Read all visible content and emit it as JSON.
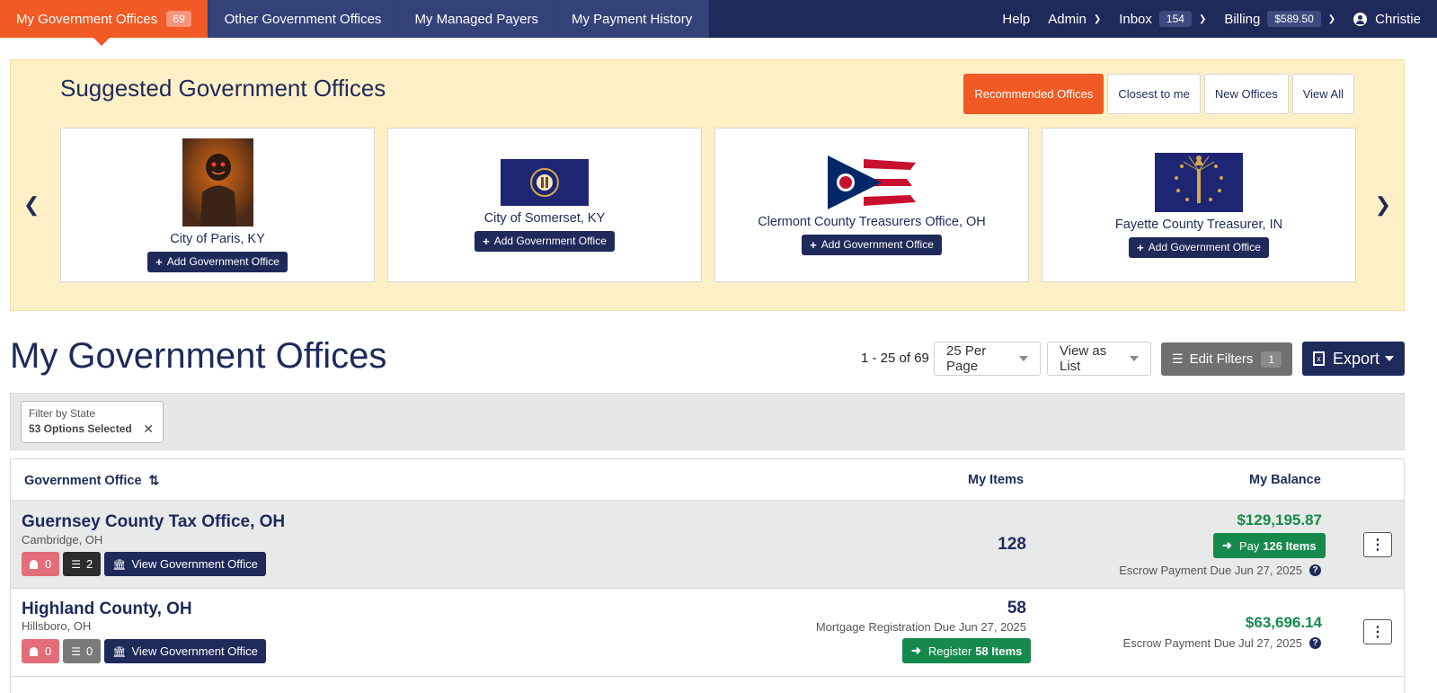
{
  "nav": {
    "tabs": [
      {
        "label": "My Government Offices",
        "badge": "69"
      },
      {
        "label": "Other Government Offices"
      },
      {
        "label": "My Managed Payers"
      },
      {
        "label": "My Payment History"
      }
    ],
    "help": "Help",
    "admin": "Admin",
    "inbox": {
      "label": "Inbox",
      "badge": "154"
    },
    "billing": {
      "label": "Billing",
      "badge": "$589.50"
    },
    "user": "Christie"
  },
  "suggested": {
    "title": "Suggested Government Offices",
    "filters": [
      "Recommended Offices",
      "Closest to me",
      "New Offices",
      "View All"
    ],
    "add_label": "Add Government Office",
    "cards": [
      {
        "name": "City of Paris, KY"
      },
      {
        "name": "City of Somerset, KY"
      },
      {
        "name": "Clermont County Treasurers Office, OH"
      },
      {
        "name": "Fayette County Treasurer, IN"
      }
    ]
  },
  "section": {
    "title": "My Government Offices",
    "pager": "1 - 25 of 69",
    "per_page": "25 Per Page",
    "view_as": "View as List",
    "edit_filters": "Edit Filters",
    "filter_count": "1",
    "export": "Export"
  },
  "filter_chip": {
    "label": "Filter by State",
    "value": "53 Options Selected"
  },
  "table": {
    "headers": {
      "office": "Government Office",
      "items": "My Items",
      "balance": "My Balance"
    },
    "view_label": "View Government Office",
    "rows": [
      {
        "name": "Guernsey County Tax Office, OH",
        "location": "Cambridge, OH",
        "alerts": "0",
        "tasks": "2",
        "items": "128",
        "balance": "$129,195.87",
        "pay_prefix": "Pay",
        "pay_items": "126 Items",
        "escrow": "Escrow Payment Due Jun 27, 2025"
      },
      {
        "name": "Highland County, OH",
        "location": "Hillsboro, OH",
        "alerts": "0",
        "tasks": "0",
        "items": "58",
        "items_note": "Mortgage Registration Due Jun 27, 2025",
        "register_prefix": "Register",
        "register_items": "58 Items",
        "balance": "$63,696.14",
        "escrow": "Escrow Payment Due Jul 27, 2025"
      }
    ]
  },
  "colors": {
    "navy": "#1e2a5a",
    "orange": "#f15a24",
    "green": "#168a4c",
    "banner": "#fdf0c6"
  }
}
